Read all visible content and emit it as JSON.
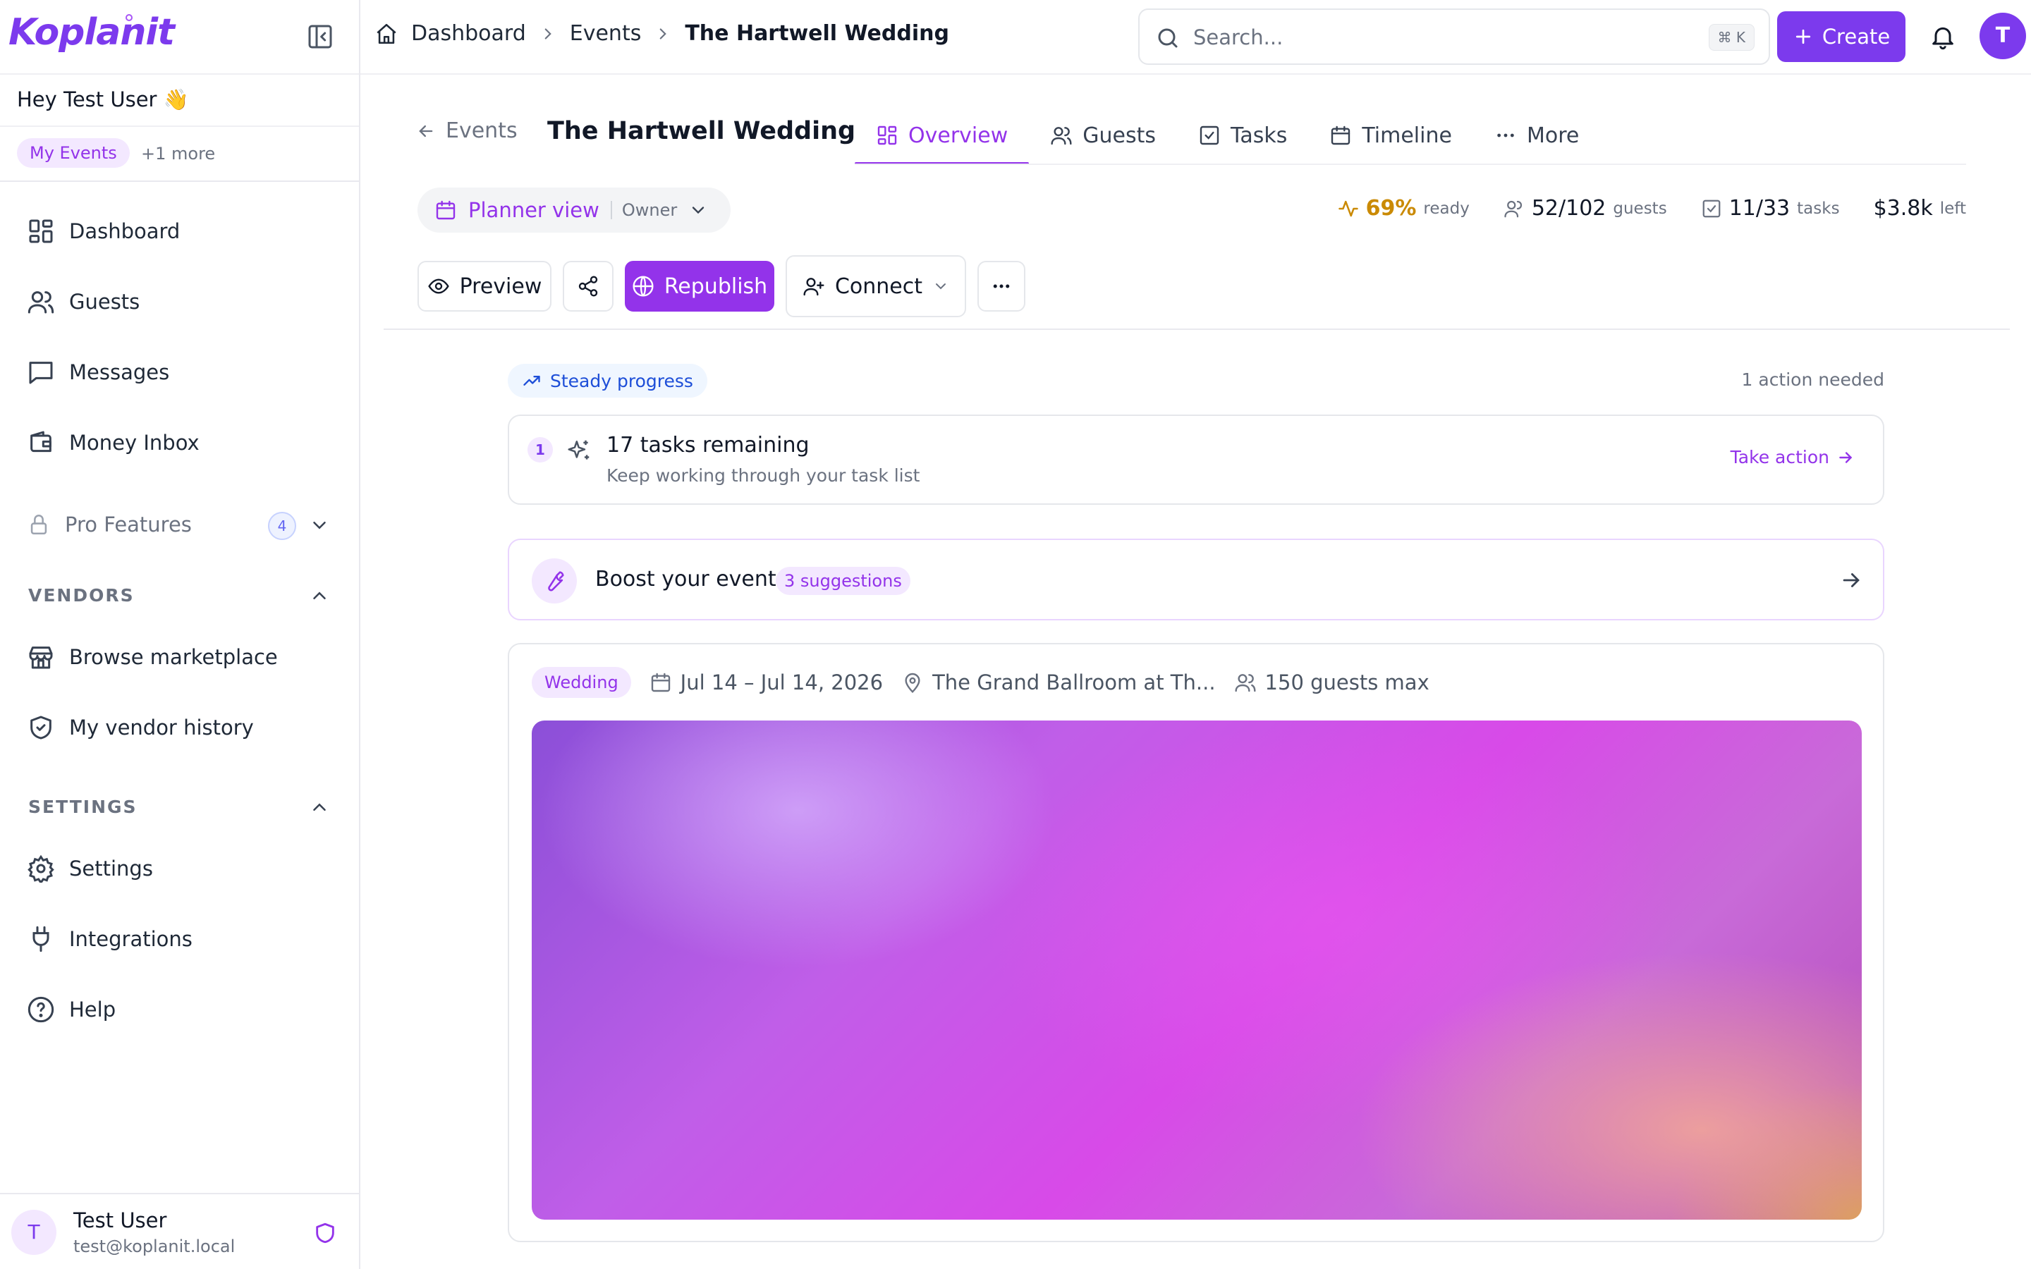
{
  "brand": {
    "name": "Koplanit",
    "accent": "#7c3aed",
    "accent_secondary": "#9333ea"
  },
  "sidebar": {
    "greeting": "Hey Test User 👋",
    "event_filter": {
      "active": "My Events",
      "more": "+1 more"
    },
    "items": [
      {
        "label": "Dashboard",
        "icon": "dashboard-icon"
      },
      {
        "label": "Guests",
        "icon": "users-icon"
      },
      {
        "label": "Messages",
        "icon": "message-icon"
      },
      {
        "label": "Money Inbox",
        "icon": "wallet-icon"
      }
    ],
    "pro_features": {
      "label": "Pro Features",
      "count": "4"
    },
    "vendors": {
      "heading": "VENDORS",
      "items": [
        {
          "label": "Browse marketplace",
          "icon": "store-icon"
        },
        {
          "label": "My vendor history",
          "icon": "shield-check-icon"
        }
      ]
    },
    "settings": {
      "heading": "SETTINGS",
      "items": [
        {
          "label": "Settings",
          "icon": "gear-icon"
        },
        {
          "label": "Integrations",
          "icon": "plug-icon"
        },
        {
          "label": "Help",
          "icon": "help-icon"
        }
      ]
    },
    "user": {
      "initial": "T",
      "name": "Test User",
      "email": "test@koplanit.local"
    }
  },
  "topbar": {
    "breadcrumb": [
      "Dashboard",
      "Events",
      "The Hartwell Wedding"
    ],
    "search_placeholder": "Search...",
    "search_shortcut": "⌘ K",
    "create_label": "Create",
    "avatar_initial": "T"
  },
  "event": {
    "back_label": "Events",
    "title": "The Hartwell Wedding",
    "tabs": [
      {
        "label": "Overview",
        "icon": "grid-icon",
        "active": true
      },
      {
        "label": "Guests",
        "icon": "users-icon",
        "active": false
      },
      {
        "label": "Tasks",
        "icon": "checkbox-icon",
        "active": false
      },
      {
        "label": "Timeline",
        "icon": "calendar-icon",
        "active": false
      },
      {
        "label": "More",
        "icon": "dots-icon",
        "active": false
      }
    ],
    "view": {
      "label": "Planner view",
      "role": "Owner"
    },
    "stats": {
      "ready_value": "69%",
      "ready_unit": "ready",
      "guests_value": "52/102",
      "guests_unit": "guests",
      "tasks_value": "11/33",
      "tasks_unit": "tasks",
      "budget_value": "$3.8k",
      "budget_unit": "left"
    },
    "actions": {
      "preview": "Preview",
      "republish": "Republish",
      "connect": "Connect"
    }
  },
  "overview": {
    "progress_label": "Steady progress",
    "actions_needed": "1 action needed",
    "task_card": {
      "number": "1",
      "title": "17 tasks remaining",
      "subtitle": "Keep working through your task list",
      "cta": "Take action"
    },
    "boost": {
      "title": "Boost your event",
      "badge": "3 suggestions"
    },
    "details": {
      "type": "Wedding",
      "dates": "Jul 14 – Jul 14, 2026",
      "venue": "The Grand Ballroom at Th...",
      "capacity": "150 guests max"
    }
  }
}
